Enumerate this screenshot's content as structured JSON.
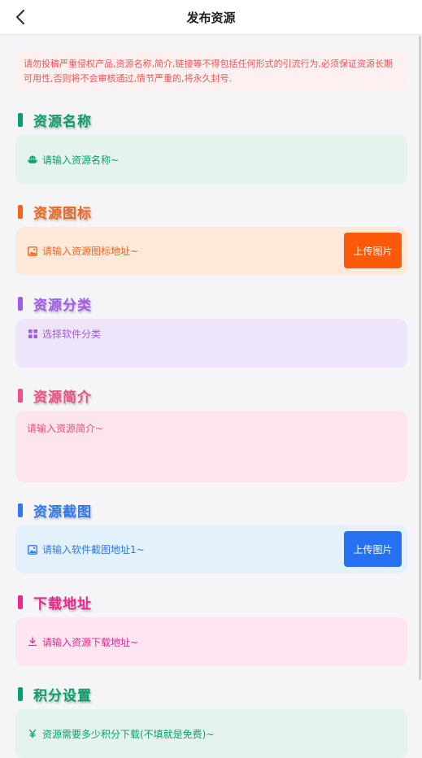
{
  "header": {
    "title": "发布资源",
    "back_icon": "chevron-left-icon"
  },
  "notice": {
    "text": "请勿投稿严重侵权产品,资源名称,简介,链接等不得包括任何形式的引流行为,必须保证资源长期可用性,否则将不会审核通过,情节严重的,将永久封号."
  },
  "sections": {
    "name": {
      "title": "资源名称",
      "color": "#0aa06e",
      "field_bg": "#e4f3ec",
      "placeholder": "请输入资源名称~",
      "icon": "android-icon"
    },
    "icon": {
      "title": "资源图标",
      "color": "#f2661c",
      "field_bg": "#fde9da",
      "placeholder": "请输入资源图标地址~",
      "icon": "image-icon",
      "button_label": "上传图片",
      "button_color": "#fb5a0a"
    },
    "category": {
      "title": "资源分类",
      "color": "#a05be8",
      "field_bg": "#efe5fb",
      "placeholder": "选择软件分类",
      "icon": "grid-icon"
    },
    "intro": {
      "title": "资源简介",
      "color": "#f04f82",
      "field_bg": "#fde5ec",
      "placeholder": "请输入资源简介~"
    },
    "screenshot": {
      "title": "资源截图",
      "color": "#2f78f0",
      "field_bg": "#e2f1fc",
      "placeholder": "请输入软件截图地址1~",
      "icon": "image-icon",
      "button_label": "上传图片",
      "button_color": "#2670f2"
    },
    "download": {
      "title": "下载地址",
      "color": "#e8288a",
      "field_bg": "#fde6f2",
      "placeholder": "请输入资源下载地址~",
      "icon": "download-icon"
    },
    "points": {
      "title": "积分设置",
      "color": "#0aa06e",
      "field_bg": "#e4f3ec",
      "placeholder": "资源需要多少积分下载(不填就是免费)~",
      "icon": "yen-icon"
    }
  }
}
